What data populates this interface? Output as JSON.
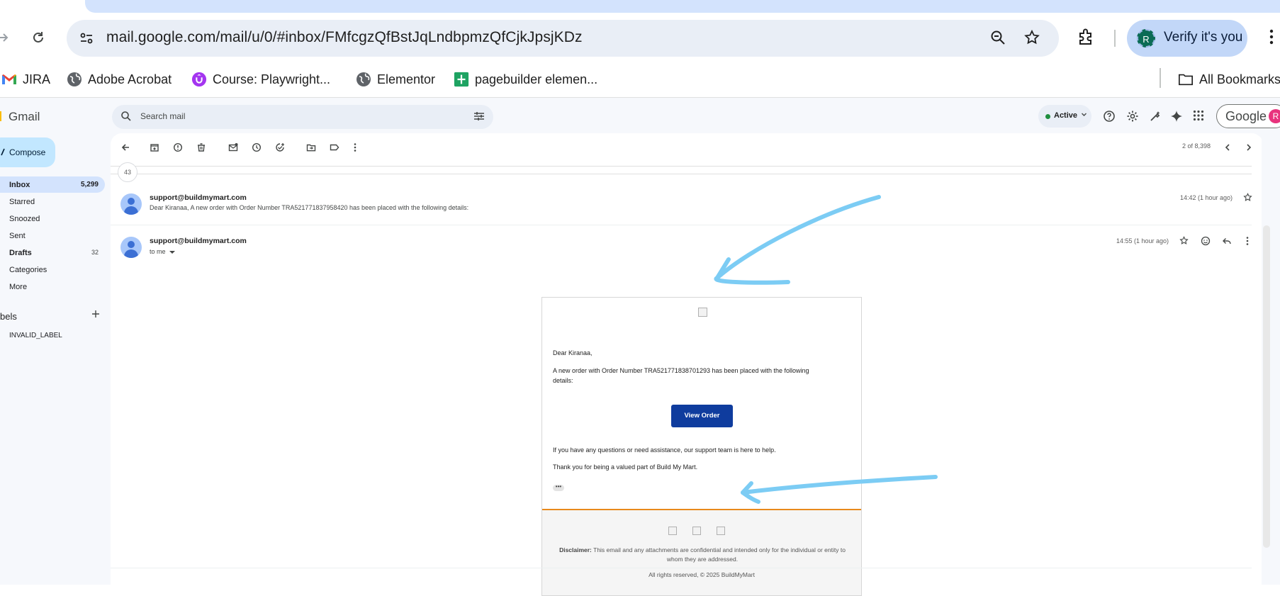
{
  "browser": {
    "url": "mail.google.com/mail/u/0/#inbox/FMfcgzQfBstJqLndbpmzQfCjkJpsjKDz",
    "verify_label": "Verify it's you",
    "avatar_letter": "R"
  },
  "bookmarks": [
    {
      "label": "JIRA",
      "icon": "gmail-icon"
    },
    {
      "label": "Adobe Acrobat",
      "icon": "globe-icon"
    },
    {
      "label": "Course: Playwright...",
      "icon": "udemy-icon"
    },
    {
      "label": "Elementor",
      "icon": "globe-icon"
    },
    {
      "label": "pagebuilder elemen...",
      "icon": "sheets-icon"
    }
  ],
  "bookmarks_all": "All Bookmarks",
  "gmail": {
    "logo_text": "Gmail",
    "search_placeholder": "Search mail",
    "status": "Active",
    "account_label": "Google",
    "account_letter": "R",
    "compose_label": "Compose",
    "nav": [
      {
        "label": "Inbox",
        "count": "5,299",
        "active": true
      },
      {
        "label": "Starred",
        "count": ""
      },
      {
        "label": "Snoozed",
        "count": ""
      },
      {
        "label": "Sent",
        "count": ""
      },
      {
        "label": "Drafts",
        "count": "32",
        "bold": true
      },
      {
        "label": "Categories",
        "count": ""
      },
      {
        "label": "More",
        "count": ""
      }
    ],
    "labels_heading": "bels",
    "labels": [
      "INVALID_LABEL"
    ]
  },
  "thread": {
    "pager": "2 of 8,398",
    "collapsed_count": "43",
    "messages": [
      {
        "from": "support@buildmymart.com",
        "snippet": "Dear Kiranaa, A new order with Order Number TRA521771837958420 has been placed with the following details:",
        "time": "14:42 (1 hour ago)"
      },
      {
        "from": "support@buildmymart.com",
        "to": "to me",
        "time": "14:55 (1 hour ago)"
      }
    ]
  },
  "email": {
    "greeting": "Dear Kiranaa,",
    "line1": "A new order with Order Number TRA521771838701293 has been placed with the following",
    "line1b": "details:",
    "button": "View Order",
    "help": "If you have any questions or need assistance, our support team is here to help.",
    "thanks": "Thank you for being a valued part of Build My Mart.",
    "more": "•••",
    "disclaimer_label": "Disclaimer:",
    "disclaimer_text": "This email and any attachments are confidential and intended only for the individual or entity to whom they are addressed.",
    "rights": "All rights reserved, © 2025 BuildMyMart"
  },
  "colors": {
    "annotation_arrow": "#7cccf4",
    "view_button": "#0f3c9e",
    "footer_rule": "#e8891c"
  }
}
